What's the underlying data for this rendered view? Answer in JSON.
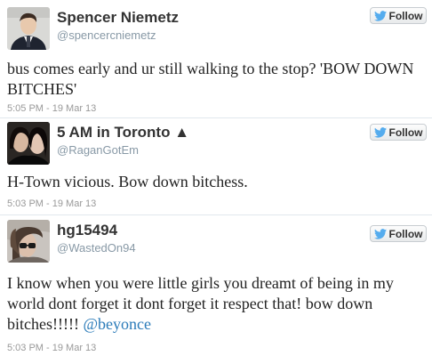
{
  "follow_label": "Follow",
  "tweets": [
    {
      "name": "Spencer Niemetz",
      "handle": "@spencercniemetz",
      "text": "bus comes early and ur still walking to the stop? 'BOW DOWN BITCHES'",
      "timestamp": "5:05 PM - 19 Mar 13"
    },
    {
      "name": "5 AM in Toronto ▲",
      "handle": "@RaganGotEm",
      "text": "H-Town vicious. Bow down bitchess.",
      "timestamp": "5:03 PM - 19 Mar 13"
    },
    {
      "name": "hg15494",
      "handle": "@WastedOn94",
      "text": "I know when you were little girls you dreamt of being in my world dont forget it dont forget it respect that! bow down bitches!!!!! ",
      "mention": "@beyonce",
      "timestamp": "5:03 PM - 19 Mar 13"
    }
  ],
  "colors": {
    "link": "#2b7bb9",
    "bird": "#55acee",
    "meta": "#999999"
  }
}
